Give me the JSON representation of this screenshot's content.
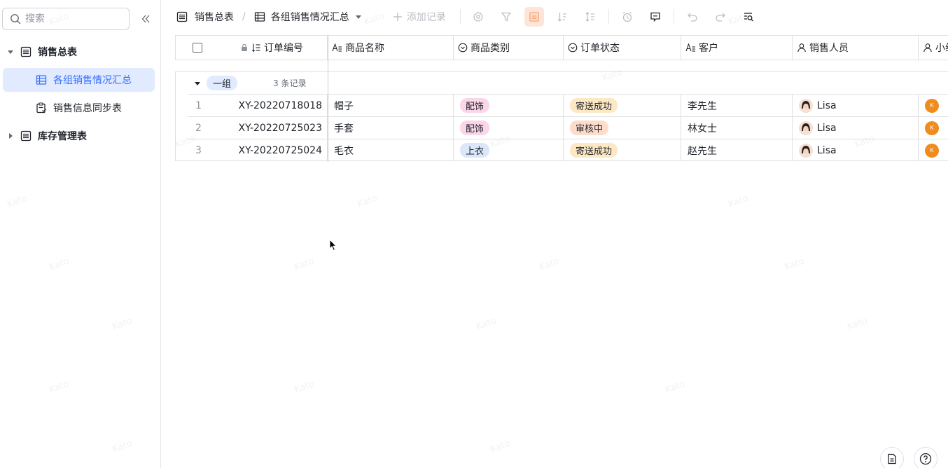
{
  "sidebar": {
    "search_placeholder": "搜索",
    "items": [
      {
        "label": "销售总表"
      },
      {
        "label": "各组销售情况汇总"
      },
      {
        "label": "销售信息同步表"
      },
      {
        "label": "库存管理表"
      }
    ]
  },
  "toolbar": {
    "crumb_root": "销售总表",
    "crumb_sep": "/",
    "crumb_view": "各组销售情况汇总",
    "add_record": "添加记录"
  },
  "table": {
    "columns": [
      "订单编号",
      "商品名称",
      "商品类别",
      "订单状态",
      "客户",
      "销售人员",
      "小组"
    ],
    "group": {
      "name": "一组",
      "count": "3 条记录"
    },
    "rows": [
      {
        "num": "1",
        "order_id": "XY-20220718018",
        "product": "帽子",
        "category": "配饰",
        "status": "寄送成功",
        "customer": "李先生",
        "seller": "Lisa",
        "team_initial": "K"
      },
      {
        "num": "2",
        "order_id": "XY-20220725023",
        "product": "手套",
        "category": "配饰",
        "status": "审核中",
        "customer": "林女士",
        "seller": "Lisa",
        "team_initial": "K"
      },
      {
        "num": "3",
        "order_id": "XY-20220725024",
        "product": "毛衣",
        "category": "上衣",
        "status": "寄送成功",
        "customer": "赵先生",
        "seller": "Lisa",
        "team_initial": "K"
      }
    ]
  },
  "colors": {
    "accent": "#3370ff",
    "category_accessory": "#fbd6e8",
    "category_top": "#dce6fb",
    "status_success": "#fde8c4",
    "status_review": "#fddccc",
    "team_avatar": "#f08c1d"
  },
  "watermark": "Kato"
}
